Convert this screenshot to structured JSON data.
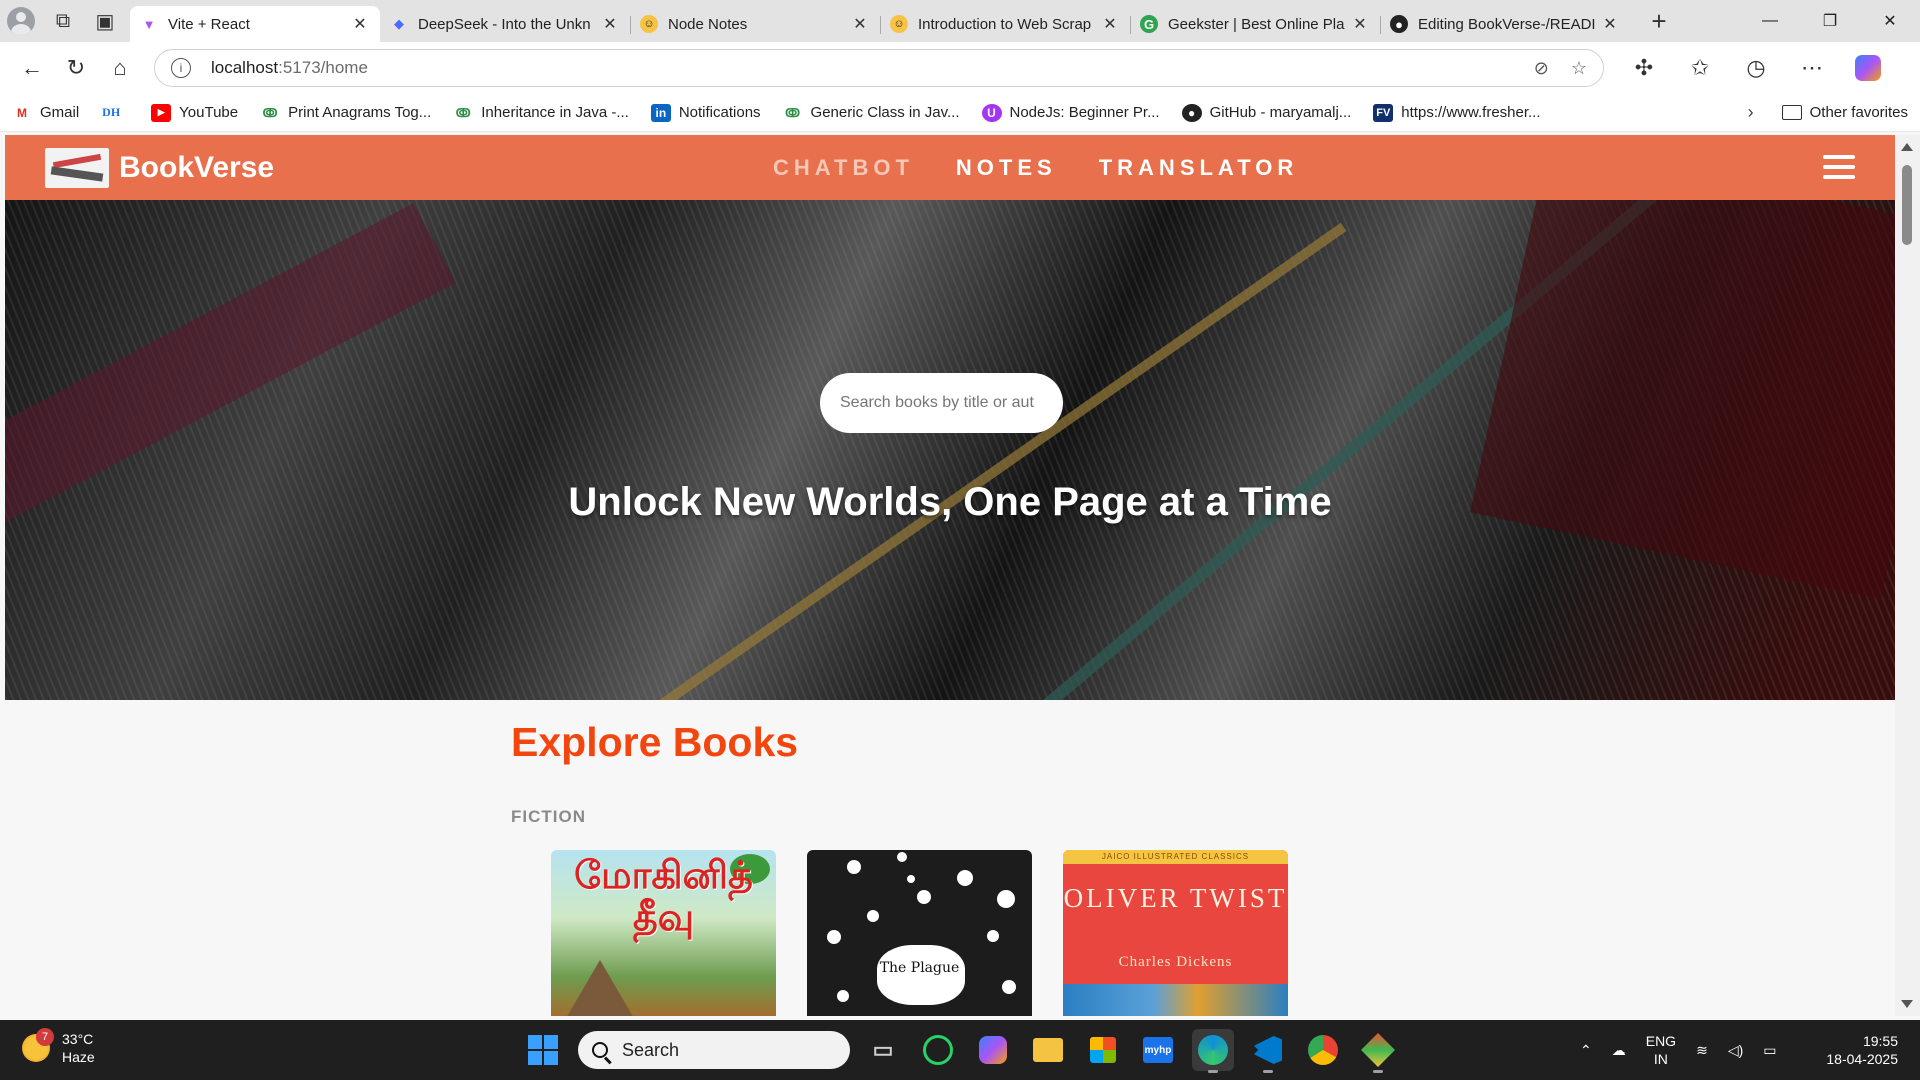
{
  "browser": {
    "tabs": [
      {
        "title": "Vite + React",
        "icon": "vite-icon",
        "active": true
      },
      {
        "title": "DeepSeek - Into the Unkn",
        "icon": "deepseek-icon",
        "active": false
      },
      {
        "title": "Node Notes",
        "icon": "smiley-icon",
        "active": false
      },
      {
        "title": "Introduction to Web Scrap",
        "icon": "smiley-icon",
        "active": false
      },
      {
        "title": "Geekster | Best Online Pla",
        "icon": "geekster-icon",
        "active": false
      },
      {
        "title": "Editing BookVerse-/READI",
        "icon": "github-icon",
        "active": false
      }
    ],
    "address": {
      "host": "localhost",
      "path": ":5173/home"
    },
    "bookmarks": [
      {
        "label": "Gmail",
        "icon": "gmail-icon"
      },
      {
        "label": "",
        "icon": "dh-icon",
        "icon_text": "DH"
      },
      {
        "label": "YouTube",
        "icon": "youtube-icon"
      },
      {
        "label": "Print Anagrams Tog...",
        "icon": "gfg-icon"
      },
      {
        "label": "Inheritance in Java -...",
        "icon": "gfg-icon"
      },
      {
        "label": "Notifications",
        "icon": "linkedin-icon"
      },
      {
        "label": "Generic Class in Jav...",
        "icon": "gfg-icon"
      },
      {
        "label": "NodeJs: Beginner Pr...",
        "icon": "udemy-icon"
      },
      {
        "label": "GitHub - maryamalj...",
        "icon": "github-icon"
      },
      {
        "label": "https://www.fresher...",
        "icon": "fv-icon"
      }
    ],
    "other_favorites": "Other favorites"
  },
  "site": {
    "brand": "BookVerse",
    "nav": [
      {
        "label": "CHATBOT",
        "dim": true
      },
      {
        "label": "NOTES",
        "dim": false
      },
      {
        "label": "TRANSLATOR",
        "dim": false
      }
    ],
    "hero": {
      "search_placeholder": "Search books by title or aut",
      "title": "Unlock New Worlds, One Page at a Time"
    },
    "explore_heading": "Explore Books",
    "category": "FICTION",
    "books": [
      {
        "cover_title": "மோகினித் தீவு"
      },
      {
        "cover_title": "The Plague"
      },
      {
        "cover_title": "OLIVER TWIST",
        "author": "Charles Dickens",
        "banner": "JAICO ILLUSTRATED CLASSICS"
      }
    ]
  },
  "taskbar": {
    "weather": {
      "temp": "33°C",
      "condition": "Haze",
      "badge": "7"
    },
    "search_label": "Search",
    "apps": [
      "task-view",
      "whatsapp",
      "copilot",
      "file-explorer",
      "store",
      "myhp",
      "edge",
      "vscode",
      "chrome",
      "git"
    ],
    "lang": {
      "line1": "ENG",
      "line2": "IN"
    },
    "time": "19:55",
    "date": "18-04-2025"
  },
  "colors": {
    "navbar": "#e8704d",
    "explore_heading": "#f2460f"
  }
}
